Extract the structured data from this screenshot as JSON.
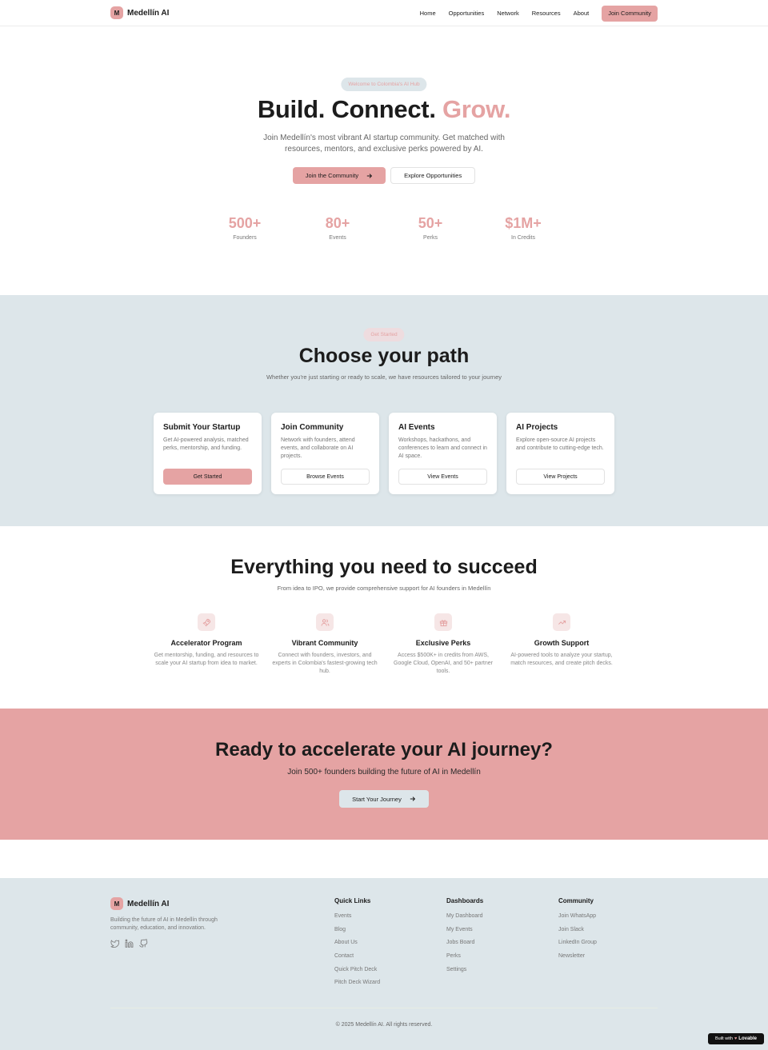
{
  "brand": {
    "initial": "M",
    "name": "Medellín AI"
  },
  "nav": {
    "links": [
      "Home",
      "Opportunities",
      "Network",
      "Resources",
      "About"
    ],
    "cta": "Join Community"
  },
  "hero": {
    "pill": "Welcome to Colombia's AI Hub",
    "title_part1": "Build. Connect.",
    "title_accent": "Grow.",
    "subtitle": "Join Medellín's most vibrant AI startup community. Get matched with resources, mentors, and exclusive perks powered by AI.",
    "primary_cta": "Join the Community",
    "secondary_cta": "Explore Opportunities",
    "stats": [
      {
        "value": "500+",
        "label": "Founders"
      },
      {
        "value": "80+",
        "label": "Events"
      },
      {
        "value": "50+",
        "label": "Perks"
      },
      {
        "value": "$1M+",
        "label": "In Credits"
      }
    ]
  },
  "path": {
    "pill": "Get Started",
    "title": "Choose your path",
    "subtitle": "Whether you're just starting or ready to scale, we have resources tailored to your journey",
    "cards": [
      {
        "title": "Submit Your Startup",
        "desc": "Get AI-powered analysis, matched perks, mentorship, and funding.",
        "button": "Get Started"
      },
      {
        "title": "Join Community",
        "desc": "Network with founders, attend events, and collaborate on AI projects.",
        "button": "Browse Events"
      },
      {
        "title": "AI Events",
        "desc": "Workshops, hackathons, and conferences to learn and connect in AI space.",
        "button": "View Events"
      },
      {
        "title": "AI Projects",
        "desc": "Explore open-source AI projects and contribute to cutting-edge tech.",
        "button": "View Projects"
      }
    ]
  },
  "features": {
    "title": "Everything you need to succeed",
    "subtitle": "From idea to IPO, we provide comprehensive support for AI founders in Medellín",
    "items": [
      {
        "icon": "rocket-icon",
        "title": "Accelerator Program",
        "desc": "Get mentorship, funding, and resources to scale your AI startup from idea to market."
      },
      {
        "icon": "users-icon",
        "title": "Vibrant Community",
        "desc": "Connect with founders, investors, and experts in Colombia's fastest-growing tech hub."
      },
      {
        "icon": "gift-icon",
        "title": "Exclusive Perks",
        "desc": "Access $500K+ in credits from AWS, Google Cloud, OpenAI, and 50+ partner tools."
      },
      {
        "icon": "trending-up-icon",
        "title": "Growth Support",
        "desc": "AI-powered tools to analyze your startup, match resources, and create pitch decks."
      }
    ]
  },
  "cta": {
    "title": "Ready to accelerate your AI journey?",
    "subtitle": "Join 500+ founders building the future of AI in Medellín",
    "button": "Start Your Journey"
  },
  "footer": {
    "description": "Building the future of AI in Medellín through community, education, and innovation.",
    "social_icons": [
      "twitter-icon",
      "linkedin-icon",
      "github-icon"
    ],
    "columns": [
      {
        "title": "Quick Links",
        "links": [
          "Events",
          "Blog",
          "About Us",
          "Contact",
          "Quick Pitch Deck",
          "Pitch Deck Wizard"
        ]
      },
      {
        "title": "Dashboards",
        "links": [
          "My Dashboard",
          "My Events",
          "Jobs Board",
          "Perks",
          "Settings"
        ]
      },
      {
        "title": "Community",
        "links": [
          "Join WhatsApp",
          "Join Slack",
          "LinkedIn Group",
          "Newsletter"
        ]
      }
    ],
    "copyright": "© 2025 Medellín AI. All rights reserved."
  },
  "badge": {
    "prefix": "Built with",
    "name": "Lovable"
  },
  "colors": {
    "accent": "#e5a3a3",
    "soft_blue": "#dde6ea",
    "text": "#1c1c1c",
    "muted": "#777777"
  }
}
